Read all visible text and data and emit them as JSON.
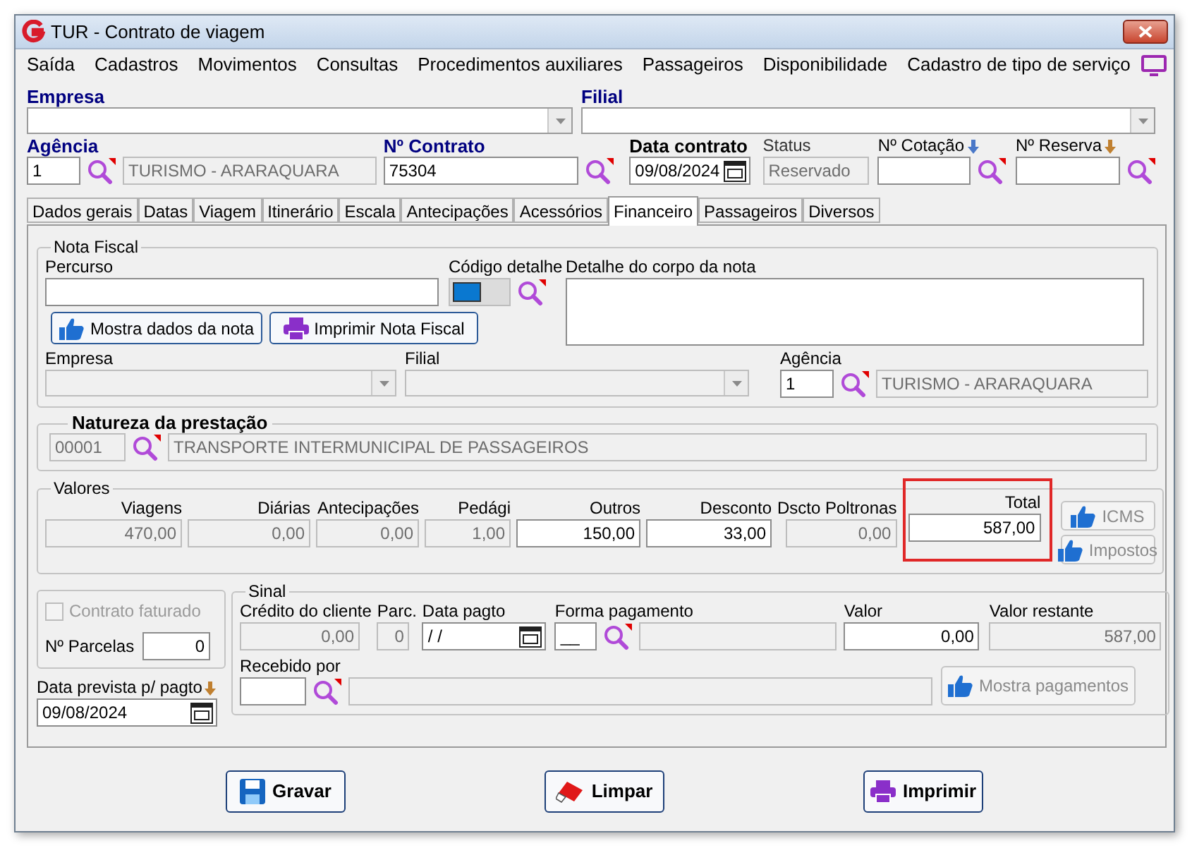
{
  "window": {
    "title": "TUR - Contrato de viagem"
  },
  "menu": [
    "Saída",
    "Cadastros",
    "Movimentos",
    "Consultas",
    "Procedimentos auxiliares",
    "Passageiros",
    "Disponibilidade",
    "Cadastro de tipo de serviço"
  ],
  "header": {
    "empresa_label": "Empresa",
    "filial_label": "Filial",
    "agencia": {
      "label": "Agência",
      "code": "1",
      "name": "TURISMO - ARARAQUARA"
    },
    "contrato": {
      "label": "Nº Contrato",
      "value": "75304"
    },
    "data_contrato": {
      "label": "Data contrato",
      "value": "09/08/2024"
    },
    "status": {
      "label": "Status",
      "value": "Reservado"
    },
    "cotacao": {
      "label": "Nº Cotação"
    },
    "reserva": {
      "label": "Nº Reserva"
    }
  },
  "tabs": [
    {
      "label": "Dados gerais",
      "selected": false
    },
    {
      "label": "Datas",
      "selected": false
    },
    {
      "label": "Viagem",
      "selected": false
    },
    {
      "label": "Itinerário",
      "selected": false
    },
    {
      "label": "Escala",
      "selected": false
    },
    {
      "label": "Antecipações",
      "selected": false
    },
    {
      "label": "Acessórios",
      "selected": false
    },
    {
      "label": "Financeiro",
      "selected": true
    },
    {
      "label": "Passageiros",
      "selected": false
    },
    {
      "label": "Diversos",
      "selected": false
    }
  ],
  "nota_fiscal": {
    "title": "Nota Fiscal",
    "percurso_label": "Percurso",
    "codigo_label": "Código detalhe",
    "detalhe_label": "Detalhe do corpo da nota",
    "buttons": [
      {
        "label": "Mostra dados da nota",
        "kind": "thumb"
      },
      {
        "label": "Imprimir Nota Fiscal",
        "kind": "print"
      }
    ],
    "empresa_label": "Empresa",
    "filial_label": "Filial",
    "agencia": {
      "label": "Agência",
      "code": "1",
      "name": "TURISMO - ARARAQUARA"
    }
  },
  "natureza": {
    "title": "Natureza da prestação",
    "code": "00001",
    "name": "TRANSPORTE INTERMUNICIPAL DE PASSAGEIROS"
  },
  "valores": {
    "title": "Valores",
    "fields": [
      {
        "label": "Viagens",
        "value": "470,00",
        "disabled": true,
        "highlighted": false
      },
      {
        "label": "Diárias",
        "value": "0,00",
        "disabled": true,
        "highlighted": false
      },
      {
        "label": "Antecipações",
        "value": "0,00",
        "disabled": true,
        "highlighted": false
      },
      {
        "label": "Pedági",
        "value": "1,00",
        "disabled": true,
        "highlighted": false
      },
      {
        "label": "Outros",
        "value": "150,00",
        "disabled": false,
        "highlighted": false
      },
      {
        "label": "Desconto",
        "value": "33,00",
        "disabled": false,
        "highlighted": false
      },
      {
        "label": "Dscto Poltronas",
        "value": "0,00",
        "disabled": true,
        "highlighted": false
      },
      {
        "label": "Total",
        "value": "587,00",
        "disabled": false,
        "highlighted": true
      }
    ],
    "buttons": [
      {
        "label": "ICMS",
        "disabled": true
      },
      {
        "label": "Impostos",
        "disabled": true
      }
    ]
  },
  "contrato_faturado": {
    "label": "Contrato faturado",
    "checked": false,
    "disabled": true
  },
  "parcelas": {
    "label": "Nº Parcelas",
    "value": "0"
  },
  "data_prevista": {
    "label": "Data prevista p/ pagto",
    "value": "09/08/2024"
  },
  "sinal": {
    "title": "Sinal",
    "credito": {
      "label": "Crédito do cliente",
      "value": "0,00"
    },
    "parc": {
      "label": "Parc.",
      "value": "0"
    },
    "data_pagto": {
      "label": "Data pagto",
      "value": "/ /"
    },
    "forma": {
      "label": "Forma pagamento",
      "value": "__"
    },
    "valor": {
      "label": "Valor",
      "value": "0,00"
    },
    "restante": {
      "label": "Valor restante",
      "value": "587,00"
    },
    "recebido_label": "Recebido por",
    "button": {
      "label": "Mostra pagamentos",
      "disabled": true
    }
  },
  "footer_buttons": [
    {
      "label": "Gravar",
      "kind": "save"
    },
    {
      "label": "Limpar",
      "kind": "clear"
    },
    {
      "label": "Imprimir",
      "kind": "print"
    }
  ]
}
